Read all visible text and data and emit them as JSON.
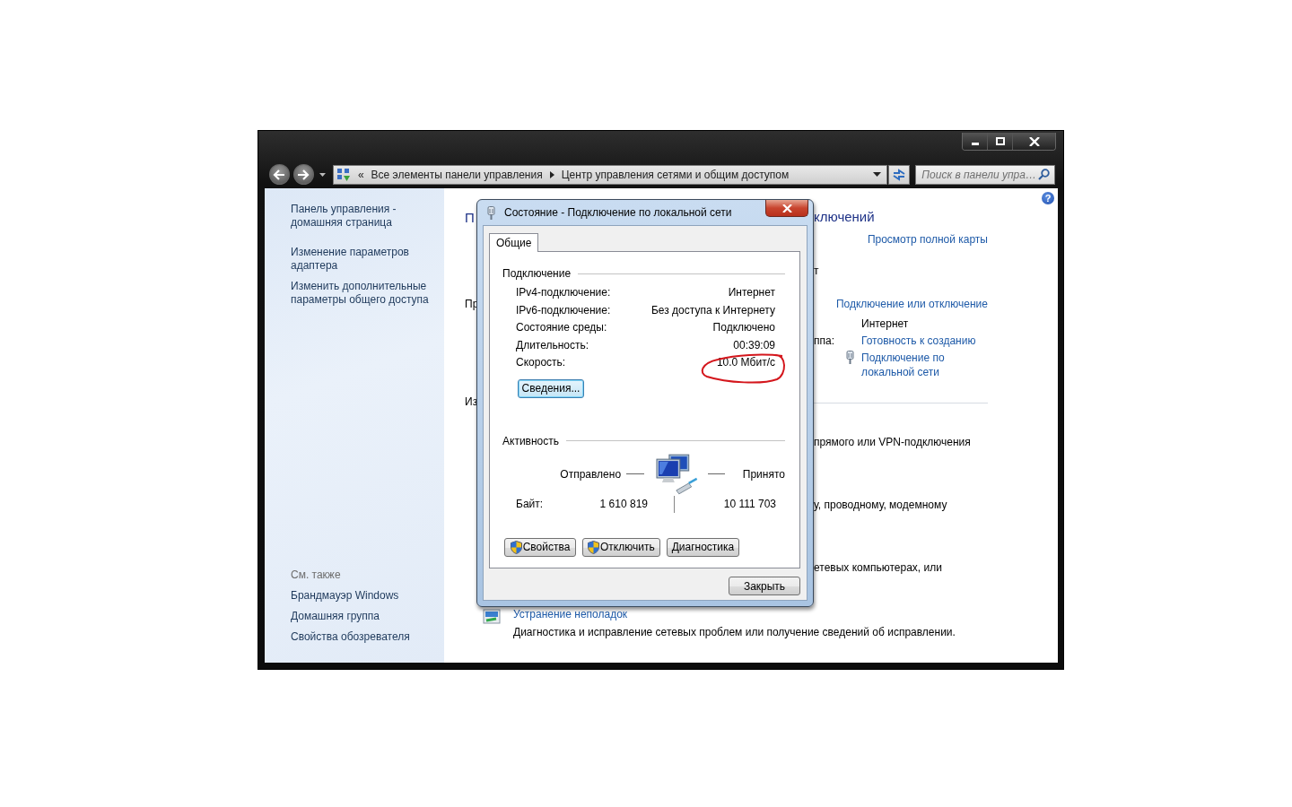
{
  "address_bar": {
    "overflow": "«",
    "crumbs": [
      "Все элементы панели управления",
      "Центр управления сетями и общим доступом"
    ]
  },
  "search": {
    "placeholder": "Поиск в панели упра…"
  },
  "help": "?",
  "sidebar": {
    "links": [
      "Панель управления - домашняя страница",
      "Изменение параметров адаптера",
      "Изменить дополнительные параметры общего доступа"
    ],
    "see_also_title": "См. также",
    "see_also": [
      "Брандмауэр Windows",
      "Домашняя группа",
      "Свойства обозревателя"
    ]
  },
  "main": {
    "left_fragments": [
      "П",
      "Пр",
      "Из"
    ],
    "title_fragment": "ключений",
    "map_link": "Просмотр полной карты",
    "type_fragment": "т",
    "connect_link": "Подключение или отключение",
    "access_type": "Интернет",
    "homegroup_label": "ппа:",
    "homegroup_link": "Готовность к созданию",
    "connections_link": "Подключение по локальной сети",
    "tasks": [
      "прямого или VPN-подключения",
      "у, проводному, модемному",
      "етевых компьютерах, или"
    ],
    "troubleshoot": {
      "title": "Устранение неполадок",
      "description": "Диагностика и исправление сетевых проблем или получение сведений об исправлении."
    }
  },
  "dialog": {
    "title": "Состояние - Подключение по локальной сети",
    "tabs": [
      {
        "label": "Общие",
        "selected": true
      }
    ],
    "connection": {
      "title": "Подключение",
      "rows": [
        {
          "label": "IPv4-подключение:",
          "value": "Интернет"
        },
        {
          "label": "IPv6-подключение:",
          "value": "Без доступа к Интернету"
        },
        {
          "label": "Состояние среды:",
          "value": "Подключено"
        },
        {
          "label": "Длительность:",
          "value": "00:39:09"
        },
        {
          "label": "Скорость:",
          "value": "10.0 Мбит/с",
          "circled": true
        }
      ],
      "details_button": "Сведения..."
    },
    "activity": {
      "title": "Активность",
      "sent": "Отправлено",
      "received": "Принято",
      "bytes_label": "Байт:",
      "bytes_sent": "1 610 819",
      "bytes_received": "10 111 703"
    },
    "buttons": [
      {
        "label": "Свойства",
        "kind": "admin"
      },
      {
        "label": "Отключить",
        "kind": "admin"
      },
      {
        "label": "Диагностика",
        "kind": "plain"
      }
    ],
    "close_button": "Закрыть"
  }
}
